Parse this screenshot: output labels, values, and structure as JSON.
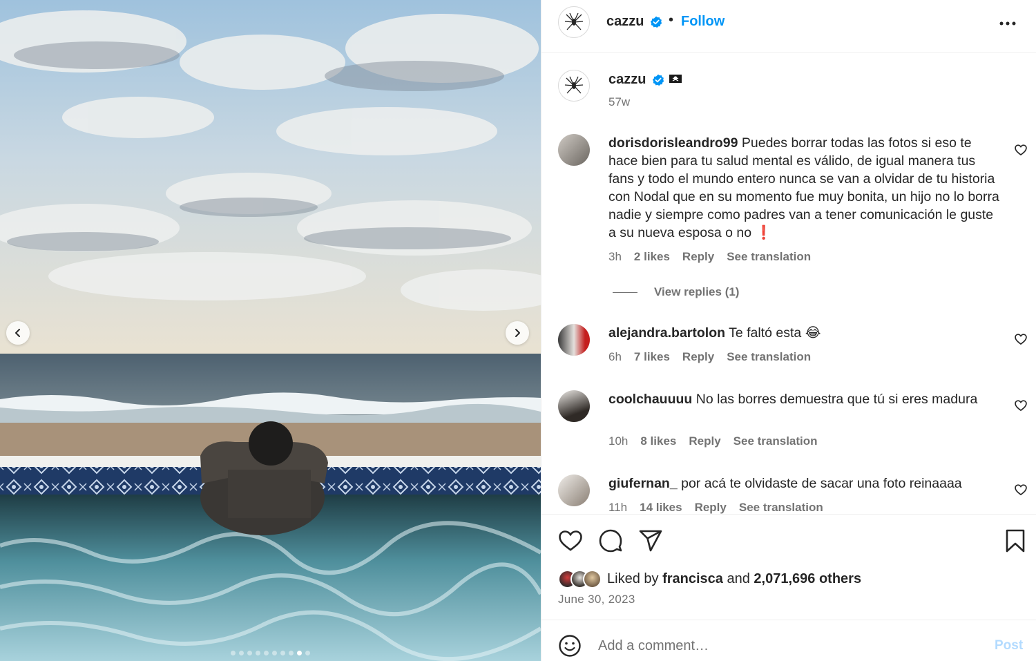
{
  "post": {
    "username": "cazzu",
    "follow_label": "Follow",
    "separator": "•",
    "caption_username": "cazzu",
    "caption_time": "57w",
    "carousel_total": 10,
    "carousel_active_index": 8
  },
  "comments": [
    {
      "username": "dorisdorisleandro99",
      "text": "Puedes borrar todas las fotos si eso te hace bien para tu salud mental es válido, de igual manera tus fans y todo el mundo entero nunca se van a olvidar de tu historia con Nodal que en su momento fue muy bonita, un hijo no lo borra nadie y siempre como padres van a tener comunicación le guste a su nueva esposa o no",
      "emoji": "❗",
      "time": "3h",
      "likes": "2 likes",
      "reply": "Reply",
      "translate": "See translation",
      "view_replies": "View replies (1)"
    },
    {
      "username": "alejandra.bartolon",
      "text": "Te faltó esta",
      "emoji": "😂",
      "time": "6h",
      "likes": "7 likes",
      "reply": "Reply",
      "translate": "See translation"
    },
    {
      "username": "coolchauuuu",
      "text": "No las borres demuestra que tú si eres madura",
      "emoji": "",
      "time": "10h",
      "likes": "8 likes",
      "reply": "Reply",
      "translate": "See translation"
    },
    {
      "username": "giufernan_",
      "text": "por acá te olvidaste de sacar una foto reinaaaa",
      "emoji": "",
      "time": "11h",
      "likes": "14 likes",
      "reply": "Reply",
      "translate": "See translation"
    }
  ],
  "likes": {
    "prefix": "Liked by",
    "user": "francisca",
    "conj": "and",
    "others": "2,071,696 others"
  },
  "date": "June 30, 2023",
  "composer": {
    "placeholder": "Add a comment…",
    "post_label": "Post"
  },
  "colors": {
    "accent": "#0095f6",
    "post_disabled": "#b3dbff",
    "secondary_text": "#737373",
    "verified": "#0095f6"
  },
  "icons": [
    "more-options-icon",
    "heart-icon",
    "comment-icon",
    "share-icon",
    "bookmark-icon",
    "emoji-icon",
    "verified-badge-icon",
    "pirate-flag-icon",
    "chevron-left-icon",
    "chevron-right-icon"
  ]
}
